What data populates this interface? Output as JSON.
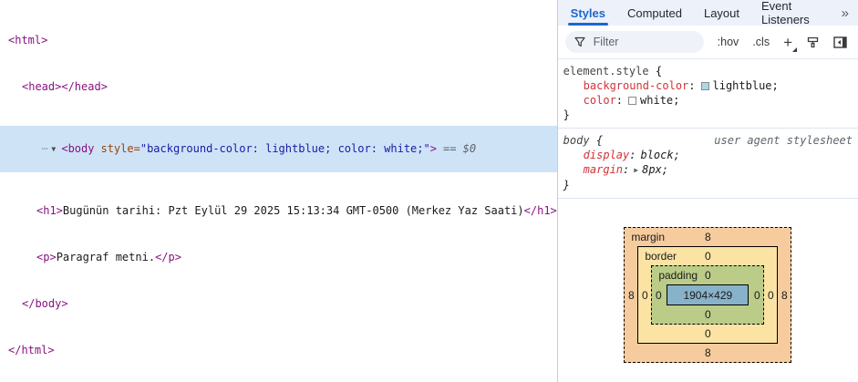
{
  "syntax": {
    "colon": ":",
    "semicolon": ";",
    "open_brace": "{",
    "close_brace": "}",
    "eq": "=",
    "expander_down": "▼",
    "expander_right": "▶",
    "hover_dots": "⋯"
  },
  "elements_panel": {
    "html_open": "<html>",
    "head_line": "<head></head>",
    "body_row": {
      "tag_open": "<body",
      "attr_name": "style",
      "attr_value": "\"background-color: lightblue; color: white;\"",
      "tag_close": ">",
      "hint": "== $0"
    },
    "h1_row": {
      "open": "<h1>",
      "text": "Bugünün tarihi: Pzt Eylül 29 2025 15:13:34 GMT-0500 (Merkez Yaz Saati)",
      "close": "</h1>"
    },
    "p_row": {
      "open": "<p>",
      "text": "Paragraf metni.",
      "close": "</p>"
    },
    "body_close": "</body>",
    "html_close": "</html>"
  },
  "styles_panel": {
    "tabs": [
      {
        "label": "Styles",
        "active": true
      },
      {
        "label": "Computed",
        "active": false
      },
      {
        "label": "Layout",
        "active": false
      },
      {
        "label": "Event Listeners",
        "active": false
      }
    ],
    "tab_overflow": "»",
    "toolbar": {
      "filter_placeholder": "Filter",
      "pseudo_toggle": ":hov",
      "class_toggle": ".cls",
      "new_rule": "+"
    },
    "rules": [
      {
        "selector": "element.style",
        "origin": "",
        "declarations": [
          {
            "property": "background-color",
            "value": "lightblue",
            "swatch": "#add8e6"
          },
          {
            "property": "color",
            "value": "white",
            "swatch": "#ffffff"
          }
        ]
      },
      {
        "selector": "body",
        "origin": "user agent stylesheet",
        "declarations": [
          {
            "property": "display",
            "value": "block"
          },
          {
            "property": "margin",
            "value": "8px",
            "expandable": true
          }
        ]
      }
    ],
    "box_model": {
      "margin_label": "margin",
      "border_label": "border",
      "padding_label": "padding",
      "margin_top": "8",
      "margin_right": "8",
      "margin_bottom": "8",
      "margin_left": "8",
      "border_top": "0",
      "border_right": "0",
      "border_bottom": "0",
      "border_left": "0",
      "padding_top": "0",
      "padding_right": "0",
      "padding_bottom": "0",
      "padding_left": "0",
      "content": "1904×429"
    },
    "colors": {
      "accent_blue": "#1a67cd",
      "selection_bg": "#cfe3f7",
      "margin_bg": "#f6cb9e",
      "border_bg": "#fbe3a4",
      "padding_bg": "#bacc88",
      "content_bg": "#88b2c9"
    }
  }
}
